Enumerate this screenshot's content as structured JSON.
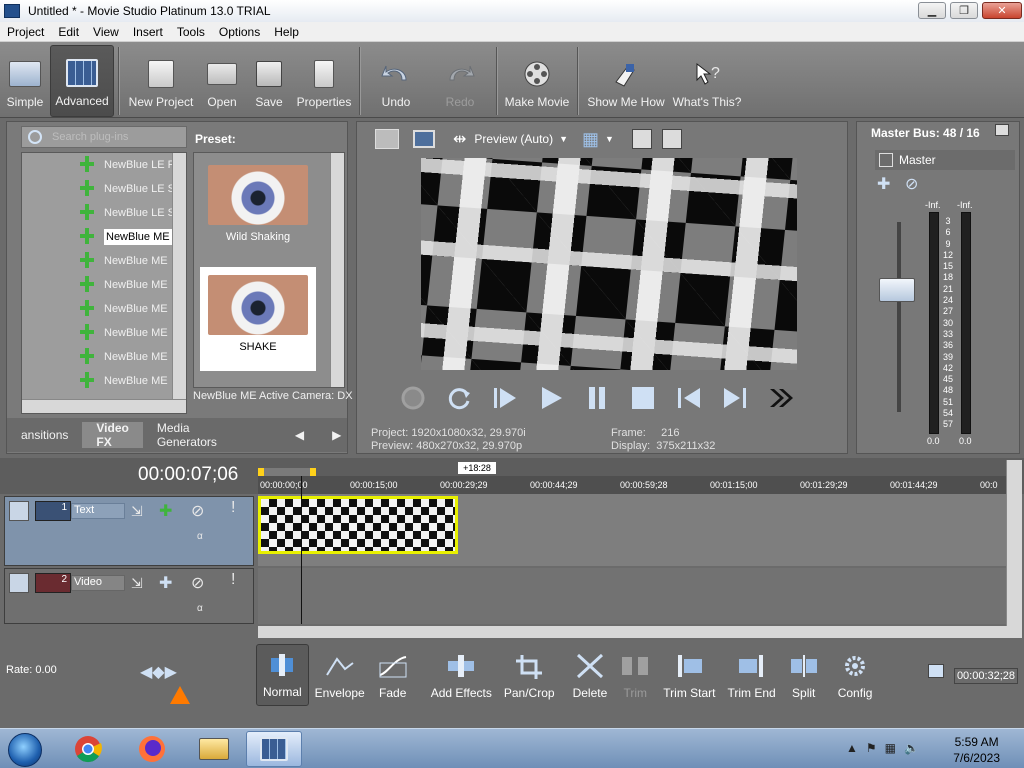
{
  "window": {
    "title": "Untitled * - Movie Studio Platinum 13.0 TRIAL"
  },
  "menu": [
    "Project",
    "Edit",
    "View",
    "Insert",
    "Tools",
    "Options",
    "Help"
  ],
  "toolbar": {
    "simple": "Simple",
    "advanced": "Advanced",
    "new_project": "New Project",
    "open": "Open",
    "save": "Save",
    "properties": "Properties",
    "undo": "Undo",
    "redo": "Redo",
    "make_movie": "Make Movie",
    "show_me_how": "Show Me How",
    "whats_this": "What's This?"
  },
  "plugins": {
    "search_placeholder": "Search plug-ins",
    "preset_label": "Preset:",
    "items": [
      "NewBlue LE F",
      "NewBlue LE S",
      "NewBlue LE S",
      "NewBlue ME",
      "NewBlue ME",
      "NewBlue ME",
      "NewBlue ME",
      "NewBlue ME",
      "NewBlue ME",
      "NewBlue ME"
    ],
    "selected_index": 3,
    "presets": [
      "Wild Shaking",
      "SHAKE"
    ],
    "selected_preset": "NewBlue ME Active Camera: DX",
    "tabs": [
      "ansitions",
      "Video FX",
      "Media Generators"
    ],
    "active_tab": "Video FX"
  },
  "preview": {
    "mode": "Preview (Auto)",
    "project_label": "Project:",
    "project_value": "1920x1080x32, 29.970i",
    "preview_label": "Preview:",
    "preview_value": "480x270x32, 29.970p",
    "frame_label": "Frame:",
    "frame_value": "216",
    "display_label": "Display:",
    "display_value": "375x211x32"
  },
  "master": {
    "title": "Master Bus: 48 / 16",
    "label": "Master",
    "inf_left": "-Inf.",
    "inf_right": "-Inf.",
    "scale": [
      "3",
      "6",
      "9",
      "12",
      "15",
      "18",
      "21",
      "24",
      "27",
      "30",
      "33",
      "36",
      "39",
      "42",
      "45",
      "48",
      "51",
      "54",
      "57"
    ],
    "bottom_left": "0.0",
    "bottom_right": "0.0"
  },
  "timeline": {
    "timecode": "00:00:07;06",
    "loop_length": "+18:28",
    "ruler": [
      "00:00:00;00",
      "00:00:15;00",
      "00:00:29;29",
      "00:00:44;29",
      "00:00:59;28",
      "00:01:15;00",
      "00:01:29;29",
      "00:01:44;29",
      "00:0"
    ],
    "tracks": [
      {
        "num": "1",
        "name": "Text"
      },
      {
        "num": "2",
        "name": "Video"
      }
    ],
    "end_timecode": "00:00:32;28",
    "rate": "Rate: 0.00"
  },
  "edit_tools": [
    "Normal",
    "Envelope",
    "Fade",
    "Add Effects",
    "Pan/Crop",
    "Delete",
    "Trim",
    "Trim Start",
    "Trim End",
    "Split",
    "Config"
  ],
  "taskbar": {
    "time": "5:59 AM",
    "date": "7/6/2023"
  },
  "colors": {
    "accent_clip_border": "#e8f000",
    "track_selected": "#8da1b9",
    "panel_bg": "#787878"
  }
}
